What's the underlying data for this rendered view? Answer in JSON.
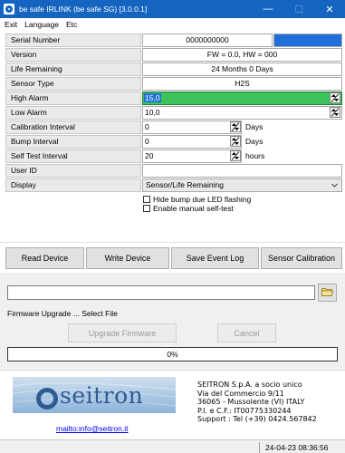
{
  "window": {
    "title": "be safe IRLINK (be safe SG) [3.0.0.1]",
    "minimize": "—",
    "maximize": "☐",
    "close": "✕"
  },
  "menu": [
    "Exit",
    "Language",
    "Etc"
  ],
  "fields": {
    "serial_number": {
      "label": "Serial Number",
      "value": "0000000000",
      "status_color": "#1e6fd9"
    },
    "version": {
      "label": "Version",
      "value": "FW = 0.0,    HW = 000"
    },
    "life_remaining": {
      "label": "Life Remaining",
      "value": "24 Months 0 Days"
    },
    "sensor_type": {
      "label": "Sensor Type",
      "value": "H2S"
    },
    "high_alarm": {
      "label": "High Alarm",
      "value": "15,0",
      "highlight_color": "#3cc45a",
      "selection_color": "#1e73d6"
    },
    "low_alarm": {
      "label": "Low Alarm",
      "value": "10,0"
    },
    "calibration_interval": {
      "label": "Calibration Interval",
      "value": "0",
      "unit": "Days"
    },
    "bump_interval": {
      "label": "Bump Interval",
      "value": "0",
      "unit": "Days"
    },
    "self_test_interval": {
      "label": "Self Test Interval",
      "value": "20",
      "unit": "hours"
    },
    "user_id": {
      "label": "User ID",
      "value": ""
    },
    "display": {
      "label": "Display",
      "value": "Sensor/Life Remaining"
    }
  },
  "options": {
    "hide_bump": "Hide bump due LED flashing",
    "enable_self_test": "Enable manual self-test"
  },
  "buttons": {
    "read_device": "Read Device",
    "write_device": "Write Device",
    "save_event_log": "Save Event Log",
    "sensor_calibration": "Sensor Calibration"
  },
  "firmware": {
    "file_path": "",
    "status": "Firmware Upgrade ... Select File",
    "upgrade_button": "Upgrade Firmware",
    "cancel_button": "Cancel",
    "progress_text": "0%",
    "progress": 0
  },
  "footer": {
    "logo_text": "seitron",
    "mailto": "mailto:info@seitron.it",
    "company_lines": [
      "SEITRON S.p.A. a socio unico",
      "Via del Commercio 9/11",
      "36065 - Mussolente (VI) ITALY",
      "P.I. e C.F.: IT00775330244",
      "Support : Tel (+39) 0424.567842"
    ]
  },
  "status_bar": {
    "datetime": "24-04-23 08:36:56"
  },
  "colors": {
    "titlebar": "#1565c0",
    "label_bg": "#eaeaea"
  },
  "icons": {
    "spin": "spin-updown-icon",
    "dropdown": "chevron-down-icon",
    "folder": "folder-icon",
    "app": "app-icon"
  }
}
